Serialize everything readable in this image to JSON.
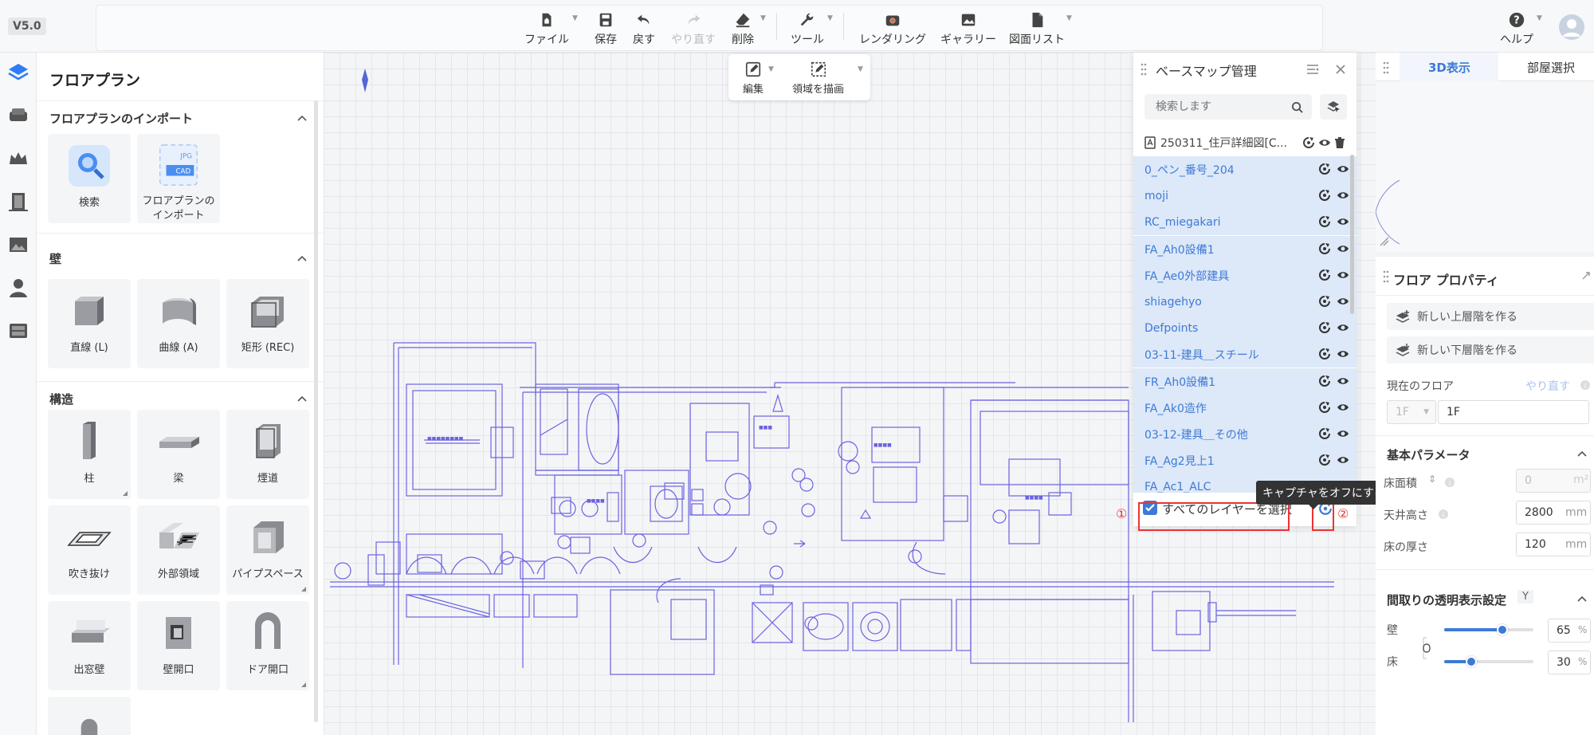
{
  "app": {
    "version": "V5.0"
  },
  "toolbar": {
    "file": "ファイル",
    "save": "保存",
    "undo": "戻す",
    "redo": "やり直す",
    "delete": "削除",
    "tools": "ツール",
    "rendering": "レンダリング",
    "gallery": "ギャラリー",
    "drawing_list": "図面リスト",
    "help": "ヘルプ"
  },
  "edit_toolbar": {
    "edit": "編集",
    "draw_area": "領域を描画"
  },
  "left_panel": {
    "title": "フロアプラン",
    "sections": [
      {
        "title": "フロアプランのインポート",
        "items": [
          "検索",
          "フロアプランの\nインポート"
        ]
      },
      {
        "title": "壁",
        "items": [
          "直線 (L)",
          "曲線 (A)",
          "矩形 (REC)"
        ]
      },
      {
        "title": "構造",
        "items": [
          "柱",
          "梁",
          "煙道",
          "吹き抜け",
          "外部領域",
          "パイプスペース",
          "出窓壁",
          "壁開口",
          "ドア開口"
        ]
      }
    ],
    "import_tile_text": {
      "jpg": "JPG",
      "cad": "CAD"
    }
  },
  "basemap": {
    "title": "ベースマップ管理",
    "search_placeholder": "検索します",
    "file_name": "250311_住戸詳細図[C...",
    "layers": [
      "0_ペン_番号_204",
      "moji",
      "RC_miegakari",
      "FA_Ah0設備1",
      "FA_Ae0外部建具",
      "shiagehyo",
      "Defpoints",
      "03-11-建具＿スチール",
      "FR_Ah0設備1",
      "FA_Ak0造作",
      "03-12-建具＿その他",
      "FA_Ag2見上1",
      "FA_Ac1_ALC"
    ],
    "select_all": "すべてのレイヤーを選択",
    "select_all_checked": true,
    "tooltip": "キャプチャをオフにする",
    "marker1": "①",
    "marker2": "②"
  },
  "view3d": {
    "tab_3d": "3D表示",
    "tab_room": "部屋選択"
  },
  "properties": {
    "title": "フロア プロパティ",
    "add_upper": "新しい上層階を作る",
    "add_lower": "新しい下層階を作る",
    "current_floor_label": "現在のフロア",
    "redo": "やり直す",
    "floor_select": "1F",
    "floor_name": "1F",
    "basic_params": "基本パラメータ",
    "floor_area_label": "床面積",
    "floor_area_value": "0",
    "floor_area_unit": "m²",
    "ceiling_label": "天井高さ",
    "ceiling_value": "2800",
    "floor_thickness_label": "床の厚さ",
    "floor_thickness_value": "120",
    "unit_mm": "mm",
    "transparency_title": "間取りの透明表示設定",
    "transparency_key": "Y",
    "wall_label": "壁",
    "wall_value": "65",
    "floor_label": "床",
    "floor_value": "30",
    "percent": "%"
  },
  "colors": {
    "accent": "#3d7ad6",
    "highlight": "#e33333",
    "plan_line": "#6b63e0"
  }
}
